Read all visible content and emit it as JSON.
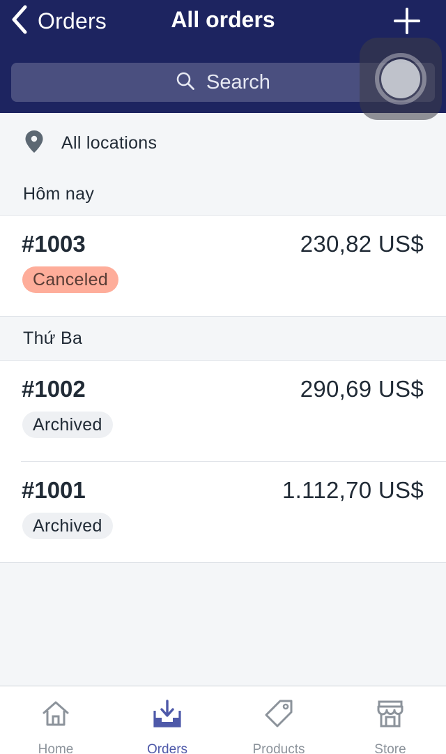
{
  "header": {
    "back_label": "Orders",
    "title": "All orders",
    "background_color": "#1d2460"
  },
  "search": {
    "placeholder": "Search"
  },
  "location": {
    "label": "All locations"
  },
  "sections": [
    {
      "label": "Hôm nay",
      "orders": [
        {
          "number": "#1003",
          "total": "230,82 US$",
          "status": "Canceled",
          "status_color": "#fead9a"
        }
      ]
    },
    {
      "label": "Thứ Ba",
      "orders": [
        {
          "number": "#1002",
          "total": "290,69 US$",
          "status": "Archived",
          "status_color": "#eef0f3"
        },
        {
          "number": "#1001",
          "total": "1.112,70 US$",
          "status": "Archived",
          "status_color": "#eef0f3"
        }
      ]
    }
  ],
  "tabbar": {
    "active_color": "#4e59a9",
    "items": [
      {
        "label": "Home",
        "icon": "home-icon",
        "active": false
      },
      {
        "label": "Orders",
        "icon": "orders-inbox-icon",
        "active": true
      },
      {
        "label": "Products",
        "icon": "tag-icon",
        "active": false
      },
      {
        "label": "Store",
        "icon": "store-icon",
        "active": false
      }
    ]
  }
}
